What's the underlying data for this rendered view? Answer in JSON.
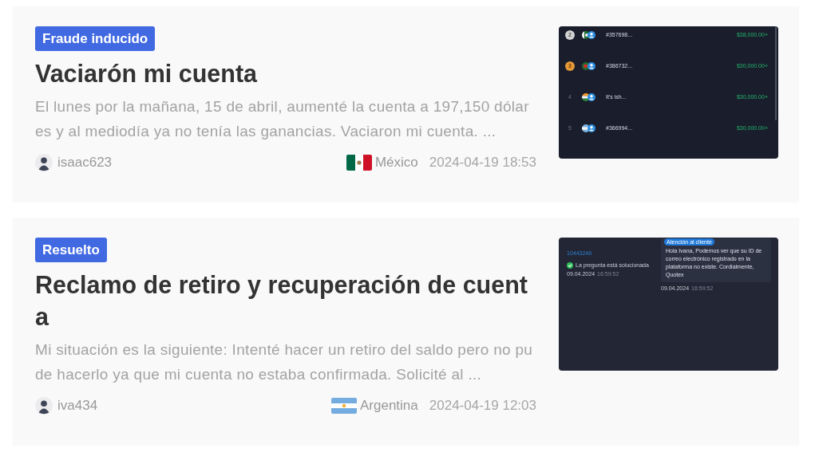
{
  "posts": [
    {
      "tag": "Fraude inducido",
      "title": "Vaciarón mi cuenta",
      "excerpt": "El lunes por la mañana, 15 de abril, aumenté la cuenta a 197,150 dólares y al mediodía ya no tenía las ganancias. Vaciaron mi cuenta. ...",
      "author": "isaac623",
      "flag": {
        "kind": "mexico"
      },
      "country": "México",
      "date": "2024-04-19 18:53",
      "thumbnail": {
        "kind": "leaderboard",
        "rows": [
          {
            "kind": "silver",
            "rank": "2",
            "flag": {
              "kind": "pakistan"
            },
            "name": "#357698...",
            "amount": "$38,000.00+"
          },
          {
            "kind": "bronze",
            "rank": "3",
            "flag": {
              "kind": "bangladesh"
            },
            "name": "#386732...",
            "amount": "$30,000.00+"
          },
          {
            "kind": "plain",
            "rank": "4",
            "flag": {
              "kind": "india"
            },
            "name": "It's ish...",
            "amount": "$30,000.00+"
          },
          {
            "kind": "plain",
            "rank": "5",
            "flag": {
              "kind": "argentina"
            },
            "name": "#366994...",
            "amount": "$30,000.00+"
          }
        ]
      }
    },
    {
      "tag": "Resuelto",
      "title": "Reclamo de retiro y recuperación de cuenta",
      "excerpt": "Mi situación es la siguiente: Intenté hacer un retiro del saldo pero no pude hacerlo ya que mi cuenta no estaba confirmada. Solicité al ...",
      "author": "iva434",
      "flag": {
        "kind": "argentina"
      },
      "country": "Argentina",
      "date": "2024-04-19 12:03",
      "thumbnail": {
        "kind": "chat",
        "ticket": "10443246",
        "status": "La pregunta está solucionada",
        "status_date": "09.04.2024",
        "status_time": "16:59:52",
        "sender": "Atención al cliente",
        "message": "Hola Ivana, Podemos ver que su ID de correo electrónico registrado en la plataforma no existe. Cordialmente, Quotex",
        "message_date": "09.04.2024",
        "message_time": "16:59:52"
      }
    }
  ]
}
